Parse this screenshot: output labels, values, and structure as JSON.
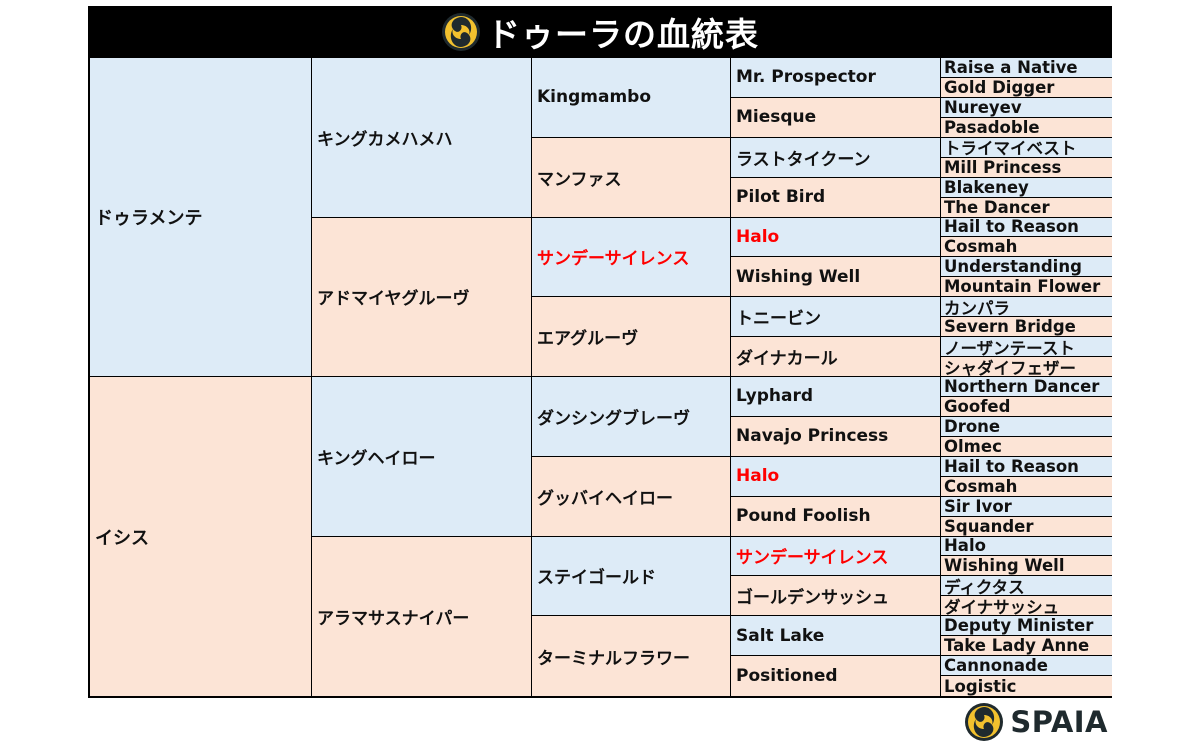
{
  "title": "ドゥーラの血統表",
  "brand": "SPAIA",
  "colors": {
    "sire_side_bg": "#ddebf7",
    "dam_side_bg": "#fce4d6",
    "highlight_text": "#ff0000",
    "title_bg": "#000000",
    "logo_yellow": "#f2c12e",
    "logo_dark": "#1f2a2e"
  },
  "pedigree": {
    "gen1": [
      {
        "name": "ドゥラメンテ",
        "side": "blue",
        "highlight": false
      },
      {
        "name": "イシス",
        "side": "pink",
        "highlight": false
      }
    ],
    "gen2": [
      {
        "name": "キングカメハメハ",
        "side": "blue",
        "highlight": false
      },
      {
        "name": "アドマイヤグルーヴ",
        "side": "pink",
        "highlight": false
      },
      {
        "name": "キングヘイロー",
        "side": "blue",
        "highlight": false
      },
      {
        "name": "アラマサスナイパー",
        "side": "pink",
        "highlight": false
      }
    ],
    "gen3": [
      {
        "name": "Kingmambo",
        "side": "blue",
        "highlight": false
      },
      {
        "name": "マンファス",
        "side": "pink",
        "highlight": false
      },
      {
        "name": "サンデーサイレンス",
        "side": "blue",
        "highlight": true
      },
      {
        "name": "エアグルーヴ",
        "side": "pink",
        "highlight": false
      },
      {
        "name": "ダンシングブレーヴ",
        "side": "blue",
        "highlight": false
      },
      {
        "name": "グッバイヘイロー",
        "side": "pink",
        "highlight": false
      },
      {
        "name": "ステイゴールド",
        "side": "blue",
        "highlight": false
      },
      {
        "name": "ターミナルフラワー",
        "side": "pink",
        "highlight": false
      }
    ],
    "gen4": [
      {
        "name": "Mr. Prospector",
        "side": "blue",
        "highlight": false
      },
      {
        "name": "Miesque",
        "side": "pink",
        "highlight": false
      },
      {
        "name": "ラストタイクーン",
        "side": "blue",
        "highlight": false
      },
      {
        "name": "Pilot Bird",
        "side": "pink",
        "highlight": false
      },
      {
        "name": "Halo",
        "side": "blue",
        "highlight": true
      },
      {
        "name": "Wishing Well",
        "side": "pink",
        "highlight": false
      },
      {
        "name": "トニービン",
        "side": "blue",
        "highlight": false
      },
      {
        "name": "ダイナカール",
        "side": "pink",
        "highlight": false
      },
      {
        "name": "Lyphard",
        "side": "blue",
        "highlight": false
      },
      {
        "name": "Navajo Princess",
        "side": "pink",
        "highlight": false
      },
      {
        "name": "Halo",
        "side": "blue",
        "highlight": true
      },
      {
        "name": "Pound Foolish",
        "side": "pink",
        "highlight": false
      },
      {
        "name": "サンデーサイレンス",
        "side": "blue",
        "highlight": true
      },
      {
        "name": "ゴールデンサッシュ",
        "side": "pink",
        "highlight": false
      },
      {
        "name": "Salt Lake",
        "side": "blue",
        "highlight": false
      },
      {
        "name": "Positioned",
        "side": "pink",
        "highlight": false
      }
    ],
    "gen5": [
      {
        "name": "Raise a Native",
        "side": "blue"
      },
      {
        "name": "Gold Digger",
        "side": "pink"
      },
      {
        "name": "Nureyev",
        "side": "blue"
      },
      {
        "name": "Pasadoble",
        "side": "pink"
      },
      {
        "name": "トライマイベスト",
        "side": "blue"
      },
      {
        "name": "Mill Princess",
        "side": "pink"
      },
      {
        "name": "Blakeney",
        "side": "blue"
      },
      {
        "name": "The Dancer",
        "side": "pink"
      },
      {
        "name": "Hail to Reason",
        "side": "blue"
      },
      {
        "name": "Cosmah",
        "side": "pink"
      },
      {
        "name": "Understanding",
        "side": "blue"
      },
      {
        "name": "Mountain Flower",
        "side": "pink"
      },
      {
        "name": "カンパラ",
        "side": "blue"
      },
      {
        "name": "Severn Bridge",
        "side": "pink"
      },
      {
        "name": "ノーザンテースト",
        "side": "blue"
      },
      {
        "name": "シャダイフェザー",
        "side": "pink"
      },
      {
        "name": "Northern Dancer",
        "side": "blue"
      },
      {
        "name": "Goofed",
        "side": "pink"
      },
      {
        "name": "Drone",
        "side": "blue"
      },
      {
        "name": "Olmec",
        "side": "pink"
      },
      {
        "name": "Hail to Reason",
        "side": "blue"
      },
      {
        "name": "Cosmah",
        "side": "pink"
      },
      {
        "name": "Sir Ivor",
        "side": "blue"
      },
      {
        "name": "Squander",
        "side": "pink"
      },
      {
        "name": "Halo",
        "side": "blue"
      },
      {
        "name": "Wishing Well",
        "side": "pink"
      },
      {
        "name": "ディクタス",
        "side": "blue"
      },
      {
        "name": "ダイナサッシュ",
        "side": "pink"
      },
      {
        "name": "Deputy Minister",
        "side": "blue"
      },
      {
        "name": "Take Lady Anne",
        "side": "pink"
      },
      {
        "name": "Cannonade",
        "side": "blue"
      },
      {
        "name": "Logistic",
        "side": "pink"
      }
    ]
  }
}
